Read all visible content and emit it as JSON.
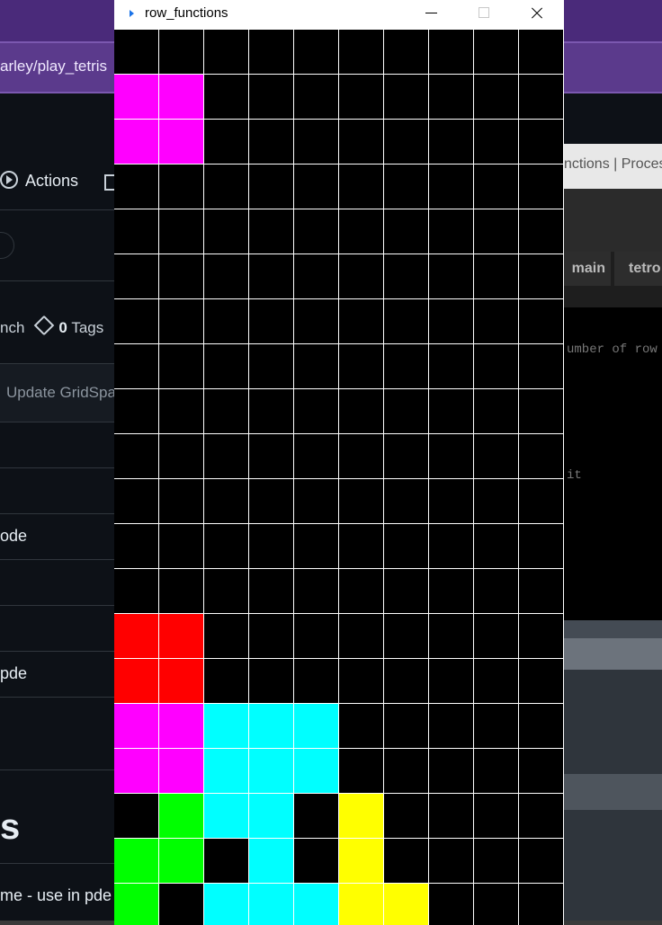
{
  "browser": {
    "url_fragment": "arley/play_tetris"
  },
  "github": {
    "actions_tab": "Actions",
    "branch_fragment": "nch",
    "tags_count": "0",
    "tags_label": "Tags",
    "commit_message": "Update GridSpa",
    "files": [
      "ode",
      "pde"
    ],
    "heading_fragment": "s",
    "readme_fragment": "me - use in pde"
  },
  "reference_page": {
    "title_fragment": "nctions | Proces",
    "tabs": [
      "main",
      "tetro"
    ],
    "code_line1": "umber of row",
    "code_line2": "it"
  },
  "window": {
    "title": "row_functions",
    "controls": [
      "minimize",
      "maximize",
      "close"
    ]
  },
  "colors": {
    "black": "#000000",
    "magenta": "#ff00ff",
    "red": "#ff0000",
    "cyan": "#00ffff",
    "green": "#00ff00",
    "yellow": "#ffff00",
    "gridline": "#ffffff"
  },
  "board": {
    "columns": 10,
    "visible_rows": 20,
    "legend": "K=empty M=magenta R=red C=cyan G=green Y=yellow",
    "rows": [
      "KKKKKKKKKK",
      "MMKKKKKKKK",
      "MMKKKKKKKK",
      "KKKKKKKKKK",
      "KKKKKKKKKK",
      "KKKKKKKKKK",
      "KKKKKKKKKK",
      "KKKKKKKKKK",
      "KKKKKKKKKK",
      "KKKKKKKKKK",
      "KKKKKKKKKK",
      "KKKKKKKKKK",
      "KKKKKKKKKK",
      "RRKKKKKKKK",
      "RRKKKKKKKK",
      "MMCCCKKKKK",
      "MMCCCKKKKK",
      "KGCCKYKKKK",
      "GGKCKYKKKK",
      "GKCCCYYKKK"
    ]
  }
}
